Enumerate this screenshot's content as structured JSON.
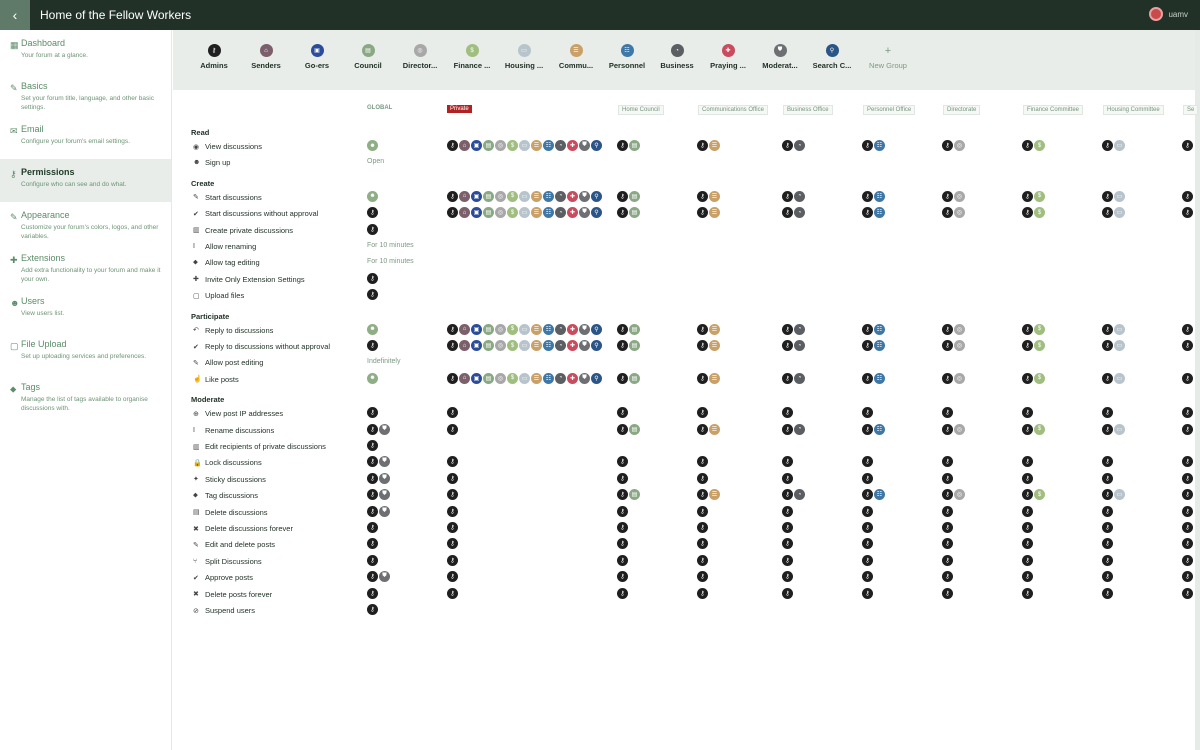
{
  "app": {
    "title": "Home of the Fellow Workers",
    "username": "uamv"
  },
  "sidebar": [
    {
      "title": "Dashboard",
      "desc": "Your forum at a glance.",
      "icon": "chart-icon",
      "glyph": "▦"
    },
    {
      "title": "Basics",
      "desc": "Set your forum title, language, and other basic settings.",
      "icon": "pencil-icon",
      "glyph": "✎"
    },
    {
      "title": "Email",
      "desc": "Configure your forum's email settings.",
      "icon": "envelope-icon",
      "glyph": "✉"
    },
    {
      "title": "Permissions",
      "desc": "Configure who can see and do what.",
      "icon": "key-icon",
      "glyph": "⚷",
      "active": true
    },
    {
      "title": "Appearance",
      "desc": "Customize your forum's colors, logos, and other variables.",
      "icon": "paint-brush-icon",
      "glyph": "✎"
    },
    {
      "title": "Extensions",
      "desc": "Add extra functionality to your forum and make it your own.",
      "icon": "puzzle-icon",
      "glyph": "✚"
    },
    {
      "title": "Users",
      "desc": "View users list.",
      "icon": "users-icon",
      "glyph": "☻"
    },
    {
      "title": "File Upload",
      "desc": "Set up uploading services and preferences.",
      "icon": "file-icon",
      "glyph": "▢"
    },
    {
      "title": "Tags",
      "desc": "Manage the list of tags available to organise discussions with.",
      "icon": "tags-icon",
      "glyph": "⬥"
    }
  ],
  "groups": [
    {
      "label": "Admins",
      "color": "#1f1f1f",
      "glyph": "⚷"
    },
    {
      "label": "Senders",
      "color": "#7b5f6b",
      "glyph": "⌂"
    },
    {
      "label": "Go-ers",
      "color": "#2b4c9b",
      "glyph": "▣"
    },
    {
      "label": "Council",
      "color": "#8aa884",
      "glyph": "▤"
    },
    {
      "label": "Director...",
      "color": "#a8a8a8",
      "glyph": "◎"
    },
    {
      "label": "Finance ...",
      "color": "#9fbe7f",
      "glyph": "$"
    },
    {
      "label": "Housing ...",
      "color": "#b8c4cc",
      "glyph": "▭"
    },
    {
      "label": "Commu...",
      "color": "#c9a168",
      "glyph": "☰"
    },
    {
      "label": "Personnel",
      "color": "#3f78a6",
      "glyph": "☷"
    },
    {
      "label": "Business",
      "color": "#5b5f63",
      "glyph": "◔"
    },
    {
      "label": "Praying ...",
      "color": "#c84b5e",
      "glyph": "✚"
    },
    {
      "label": "Moderat...",
      "color": "#6d6f72",
      "glyph": "⛊"
    },
    {
      "label": "Search C...",
      "color": "#2b5587",
      "glyph": "⚲"
    }
  ],
  "new_group": "New Group",
  "scopes": [
    "GLOBAL",
    "Private",
    "Home Council",
    "Communications Office",
    "Business Office",
    "Personnel Office",
    "Directorate",
    "Finance Committee",
    "Housing Committee",
    "Se"
  ],
  "sections": [
    {
      "title": "Read",
      "rows": [
        {
          "label": "View discussions",
          "icon": "eye-icon",
          "glyph": "◉",
          "g": "m",
          "p": "all",
          "t": "pair"
        },
        {
          "label": "Sign up",
          "icon": "user-plus-icon",
          "glyph": "☻",
          "g": "Open"
        }
      ]
    },
    {
      "title": "Create",
      "rows": [
        {
          "label": "Start discussions",
          "icon": "edit-icon",
          "glyph": "✎",
          "g": "m",
          "p": "all",
          "t": "pair"
        },
        {
          "label": "Start discussions without approval",
          "icon": "check-icon",
          "glyph": "✔",
          "g": "a",
          "p": "all",
          "t": "pair"
        },
        {
          "label": "Create private discussions",
          "icon": "map-icon",
          "glyph": "▥",
          "g": "a"
        },
        {
          "label": "Allow renaming",
          "icon": "text-cursor-icon",
          "glyph": "I",
          "g": "For 10 minutes"
        },
        {
          "label": "Allow tag editing",
          "icon": "tag-icon",
          "glyph": "⬥",
          "g": "For 10 minutes"
        },
        {
          "label": "Invite Only Extension Settings",
          "icon": "plus-icon",
          "glyph": "✚",
          "g": "a"
        },
        {
          "label": "Upload files",
          "icon": "file-icon",
          "glyph": "▢",
          "g": "a"
        }
      ]
    },
    {
      "title": "Participate",
      "rows": [
        {
          "label": "Reply to discussions",
          "icon": "reply-icon",
          "glyph": "↶",
          "g": "m",
          "p": "all",
          "t": "pair"
        },
        {
          "label": "Reply to discussions without approval",
          "icon": "check-icon",
          "glyph": "✔",
          "g": "a",
          "p": "all",
          "t": "pair"
        },
        {
          "label": "Allow post editing",
          "icon": "pencil-icon",
          "glyph": "✎",
          "g": "Indefinitely"
        },
        {
          "label": "Like posts",
          "icon": "thumbs-up-icon",
          "glyph": "☝",
          "g": "m",
          "p": "all",
          "t": "pair"
        }
      ]
    },
    {
      "title": "Moderate",
      "rows": [
        {
          "label": "View post IP addresses",
          "icon": "globe-icon",
          "glyph": "⊕",
          "g": "a",
          "p": "a",
          "t": "admin"
        },
        {
          "label": "Rename discussions",
          "icon": "text-cursor-icon",
          "glyph": "I",
          "g": "am",
          "p": "a",
          "t": "pair"
        },
        {
          "label": "Edit recipients of private discussions",
          "icon": "map-icon",
          "glyph": "▥",
          "g": "a"
        },
        {
          "label": "Lock discussions",
          "icon": "lock-icon",
          "glyph": "🔒",
          "g": "am",
          "p": "a",
          "t": "admin"
        },
        {
          "label": "Sticky discussions",
          "icon": "thumbtack-icon",
          "glyph": "✦",
          "g": "am",
          "p": "a",
          "t": "admin"
        },
        {
          "label": "Tag discussions",
          "icon": "tag-icon",
          "glyph": "⬥",
          "g": "am",
          "p": "a",
          "t": "pair"
        },
        {
          "label": "Delete discussions",
          "icon": "trash-icon",
          "glyph": "▤",
          "g": "am",
          "p": "a",
          "t": "admin"
        },
        {
          "label": "Delete discussions forever",
          "icon": "times-icon",
          "glyph": "✖",
          "g": "a",
          "p": "a",
          "t": "admin"
        },
        {
          "label": "Edit and delete posts",
          "icon": "pencil-icon",
          "glyph": "✎",
          "g": "a",
          "p": "a",
          "t": "admin"
        },
        {
          "label": "Split Discussions",
          "icon": "code-branch-icon",
          "glyph": "⑂",
          "g": "a",
          "p": "a",
          "t": "admin"
        },
        {
          "label": "Approve posts",
          "icon": "check-icon",
          "glyph": "✔",
          "g": "am",
          "p": "a",
          "t": "admin"
        },
        {
          "label": "Delete posts forever",
          "icon": "times-icon",
          "glyph": "✖",
          "g": "a",
          "p": "a",
          "t": "admin"
        },
        {
          "label": "Suspend users",
          "icon": "ban-icon",
          "glyph": "⊘",
          "g": "a"
        }
      ]
    }
  ],
  "colors": {
    "member": "#8fae86",
    "admin": "#1f1f1f",
    "moderator": "#6d6f72",
    "topbar": "#223128"
  }
}
